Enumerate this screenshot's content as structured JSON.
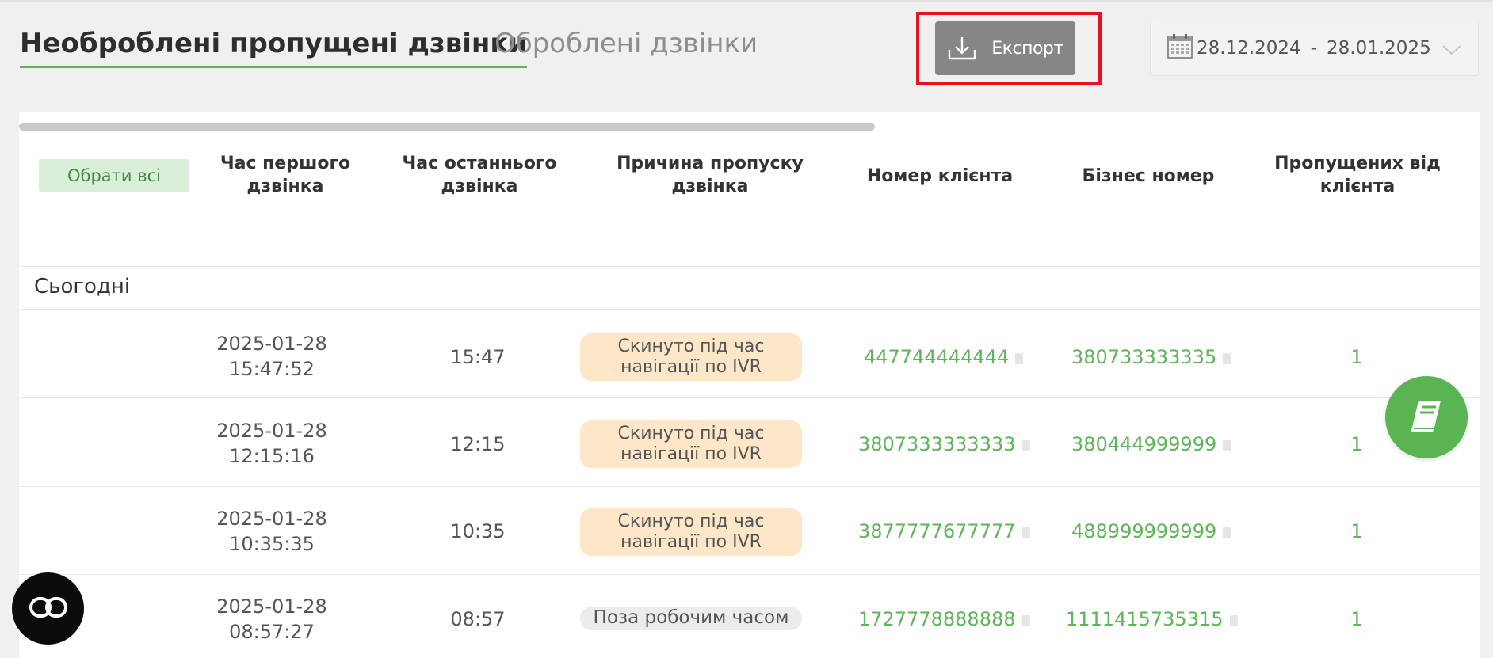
{
  "tabs": {
    "active": "Необроблені пропущені дзвінки",
    "inactive": "Оброблені дзвінки"
  },
  "toolbar": {
    "export_label": "Експорт",
    "export_icon": "download-icon",
    "date_from": "28.12.2024",
    "date_separator": "-",
    "date_to": "28.01.2025",
    "calendar_icon": "calendar-icon",
    "dropdown_icon": "chevron-down-icon"
  },
  "table": {
    "select_all_label": "Обрати всі",
    "headers": {
      "first_call_line1": "Час першого",
      "first_call_line2": "дзвінка",
      "last_call_line1": "Час останнього",
      "last_call_line2": "дзвінка",
      "reason_line1": "Причина пропуску",
      "reason_line2": "дзвінка",
      "client_number": "Номер клієнта",
      "business_number": "Бізнес номер",
      "missed_line1": "Пропущених від",
      "missed_line2": "клієнта"
    },
    "group_label": "Сьогодні",
    "rows": [
      {
        "first_date": "2025-01-28",
        "first_time": "15:47:52",
        "last_time": "15:47",
        "reason_line1": "Скинуто під час",
        "reason_line2": "навігації по IVR",
        "client_number": "447744444444",
        "business_number": "380733333335",
        "missed": "1"
      },
      {
        "first_date": "2025-01-28",
        "first_time": "12:15:16",
        "last_time": "12:15",
        "reason_line1": "Скинуто під час",
        "reason_line2": "навігації по IVR",
        "client_number": "3807333333333",
        "business_number": "380444999999",
        "missed": "1"
      },
      {
        "first_date": "2025-01-28",
        "first_time": "10:35:35",
        "last_time": "10:35",
        "reason_line1": "Скинуто під час",
        "reason_line2": "навігації по IVR",
        "client_number": "3877777677777",
        "business_number": "488999999999",
        "missed": "1"
      },
      {
        "first_date": "2025-01-28",
        "first_time": "08:57:27",
        "last_time": "08:57",
        "reason_line1": "Поза робочим часом",
        "client_number": "1727778888888",
        "business_number": "1111415735315",
        "missed": "1"
      }
    ]
  },
  "floating": {
    "notes_icon": "notebook-icon",
    "chat_icon": "chat-logo-icon"
  },
  "colors": {
    "accent_green": "#5fb35b",
    "export_bg": "#868686",
    "highlight_red": "#e3141d",
    "reason_bg": "#fde7c8"
  }
}
